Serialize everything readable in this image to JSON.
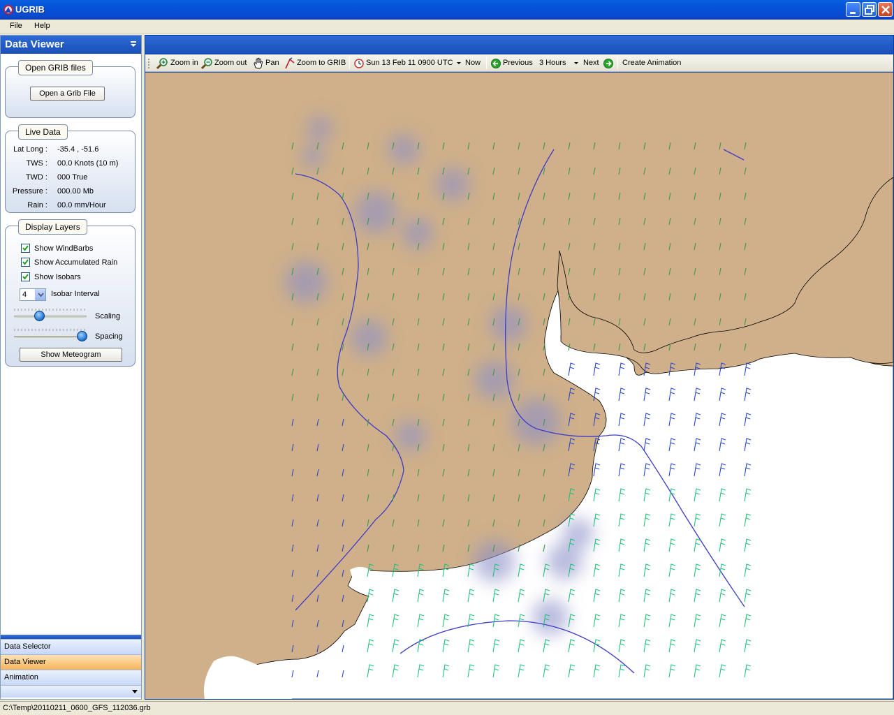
{
  "window": {
    "title": "UGRIB"
  },
  "menu": {
    "file": "File",
    "help": "Help"
  },
  "left_panel": {
    "title": "Data Viewer",
    "open_group": {
      "title": "Open GRIB files",
      "button": "Open a Grib File"
    },
    "live_data": {
      "title": "Live Data",
      "rows": [
        {
          "label": "Lat Long :",
          "value": "-35.4 ,  -51.6"
        },
        {
          "label": "TWS :",
          "value": "00.0 Knots (10 m)"
        },
        {
          "label": "TWD :",
          "value": "000 True"
        },
        {
          "label": "Pressure :",
          "value": "000.00 Mb"
        },
        {
          "label": "Rain :",
          "value": "00.0 mm/Hour"
        }
      ]
    },
    "display_layers": {
      "title": "Display Layers",
      "checkboxes": [
        {
          "label": "Show WindBarbs",
          "checked": true
        },
        {
          "label": "Show Accumulated Rain",
          "checked": true
        },
        {
          "label": "Show Isobars",
          "checked": true
        }
      ],
      "isobar_interval_value": "4",
      "isobar_interval_label": "Isobar Interval",
      "scaling_label": "Scaling",
      "scaling_level": 0.3,
      "spacing_label": "Spacing",
      "spacing_level": 0.95,
      "meteogram_button": "Show Meteogram"
    },
    "nav_tabs": [
      {
        "label": "Data Selector",
        "active": false
      },
      {
        "label": "Data Viewer",
        "active": true
      },
      {
        "label": "Animation",
        "active": false
      }
    ]
  },
  "toolbar": {
    "zoom_in": "Zoom in",
    "zoom_out": "Zoom out",
    "pan": "Pan",
    "zoom_to_grib": "Zoom to GRIB",
    "datetime": "Sun 13 Feb 11 0900 UTC",
    "now": "Now",
    "previous": "Previous",
    "step": "3 Hours",
    "next": "Next",
    "create_animation": "Create Animation"
  },
  "map": {
    "land_color": "#cfb08a",
    "sea_color": "#ffffff",
    "isobar_color": "#3b3bc8",
    "rain_color": "#8a90c8"
  },
  "status": {
    "path": "C:\\Temp\\20110211_0600_GFS_112036.grb"
  }
}
